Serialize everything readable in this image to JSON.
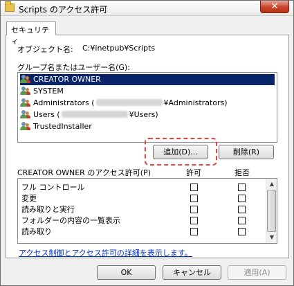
{
  "window": {
    "title": "Scripts のアクセス許可",
    "close_label": "✕"
  },
  "tab": {
    "label": "セキュリティ"
  },
  "object": {
    "label": "オブジェクト名:",
    "value": "C:¥inetpub¥Scripts"
  },
  "groups": {
    "label": "グループ名またはユーザー名(G):",
    "items": [
      {
        "name": "CREATOR OWNER",
        "selected": true
      },
      {
        "name": "SYSTEM"
      },
      {
        "prefix": "Administrators (",
        "suffix": "¥Administrators)"
      },
      {
        "prefix": "Users (",
        "suffix": "¥Users)"
      },
      {
        "name": "TrustedInstaller"
      }
    ]
  },
  "buttons": {
    "add": "追加(D)...",
    "remove": "削除(R)",
    "ok": "OK",
    "cancel": "キャンセル",
    "apply": "適用(A)"
  },
  "permissions": {
    "label": "CREATOR OWNER のアクセス許可(P)",
    "allow_header": "許可",
    "deny_header": "拒否",
    "rows": [
      {
        "name": "フル コントロール",
        "allow": false,
        "deny": false
      },
      {
        "name": "変更",
        "allow": false,
        "deny": false
      },
      {
        "name": "読み取りと実行",
        "allow": false,
        "deny": false
      },
      {
        "name": "フォルダーの内容の一覧表示",
        "allow": false,
        "deny": false
      },
      {
        "name": "読み取り",
        "allow": false,
        "deny": false
      }
    ]
  },
  "link": {
    "text": "アクセス制御とアクセス許可の詳細を表示します。"
  },
  "colors": {
    "accent_highlight": "#e8423a",
    "selection": "#0a246a",
    "link": "#0033cc"
  }
}
